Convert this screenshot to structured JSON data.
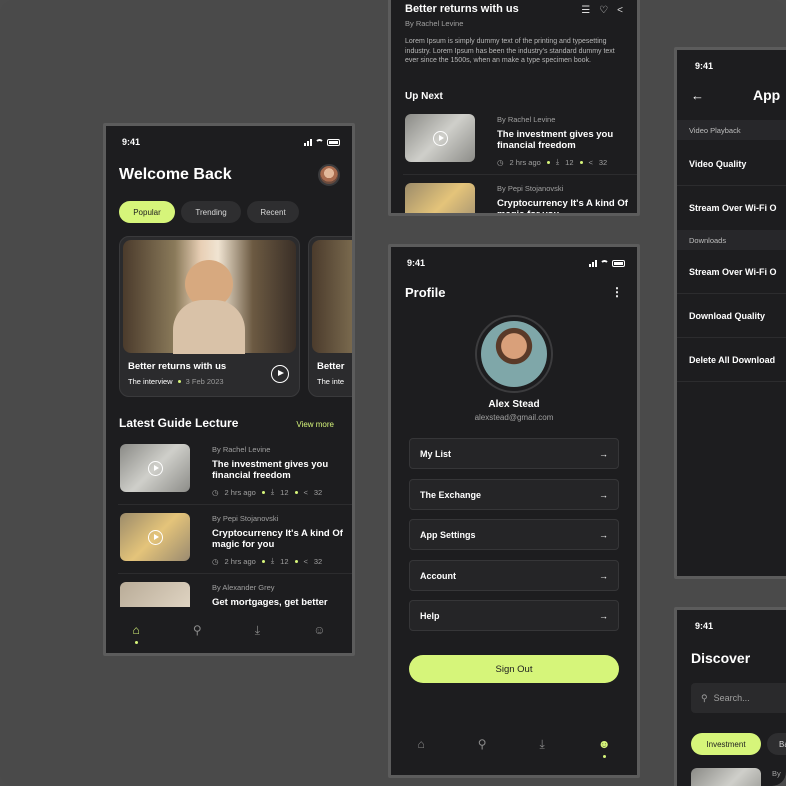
{
  "status_time": "9:41",
  "colors": {
    "accent": "#d6f57a",
    "bg": "#1d1d1f",
    "frame": "#5c5c5c"
  },
  "home": {
    "title": "Welcome Back",
    "tabs": [
      "Popular",
      "Trending",
      "Recent"
    ],
    "hero": {
      "title": "Better returns with us",
      "sub": "The interview",
      "date": "3 Feb 2023"
    },
    "hero2": {
      "title": "Better",
      "sub": "The inte"
    },
    "section_title": "Latest Guide Lecture",
    "view_more": "View more",
    "lectures": [
      {
        "author": "By Rachel Levine",
        "title": "The investment gives you financial freedom",
        "time": "2 hrs ago",
        "downloads": "12",
        "shares": "32"
      },
      {
        "author": "By Pepi Stojanovski",
        "title": "Cryptocurrency It's A kind Of magic for you",
        "time": "2 hrs ago",
        "downloads": "12",
        "shares": "32"
      },
      {
        "author": "By Alexander Grey",
        "title": "Get mortgages, get better",
        "time": "",
        "downloads": "",
        "shares": ""
      }
    ]
  },
  "video": {
    "title": "Better returns with us",
    "author": "By Rachel Levine",
    "description": "Lorem Ipsum is simply dummy text of the printing and typesetting industry. Lorem Ipsum has been the industry's standard dummy text ever since the 1500s, when an make a type specimen book.",
    "up_next": "Up Next",
    "items": [
      {
        "author": "By Rachel Levine",
        "title": "The investment gives you financial freedom",
        "time": "2 hrs ago",
        "downloads": "12",
        "shares": "32"
      },
      {
        "author": "By Pepi Stojanovski",
        "title": "Cryptocurrency It's A kind Of magic for you"
      }
    ]
  },
  "profile": {
    "title": "Profile",
    "name": "Alex Stead",
    "email": "alexstead@gmail.com",
    "menu": [
      "My List",
      "The Exchange",
      "App Settings",
      "Account",
      "Help"
    ],
    "sign_out": "Sign Out"
  },
  "settings": {
    "title": "App",
    "sections": [
      {
        "header": "Video Playback",
        "rows": [
          "Video Quality",
          "Stream Over Wi-Fi O"
        ]
      },
      {
        "header": "Downloads",
        "rows": [
          "Stream Over Wi-Fi O",
          "Download Quality",
          "Delete All Download"
        ]
      }
    ]
  },
  "discover": {
    "title": "Discover",
    "search_placeholder": "Search...",
    "chips": [
      "Investment",
      "Ba"
    ],
    "item_author": "By"
  }
}
